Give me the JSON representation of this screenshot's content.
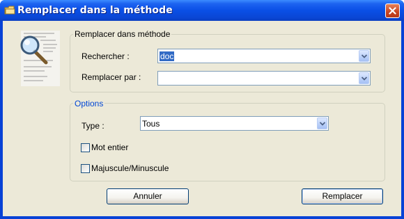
{
  "window": {
    "title": "Remplacer dans la méthode",
    "icon": "folder-icon",
    "close_icon": "close-icon"
  },
  "decoration": {
    "icon": "magnifier-document-icon"
  },
  "replace_group": {
    "legend": "Remplacer dans méthode",
    "search_label": "Rechercher :",
    "search_value": "doc",
    "replace_label": "Remplacer par :",
    "replace_value": ""
  },
  "options_group": {
    "legend": "Options",
    "type_label": "Type :",
    "type_value": "Tous",
    "whole_word_label": "Mot entier",
    "whole_word_checked": false,
    "match_case_label": "Majuscule/Minuscule",
    "match_case_checked": false
  },
  "buttons": {
    "cancel": "Annuler",
    "replace": "Remplacer"
  },
  "colors": {
    "title_bar": "#0a4fe6",
    "dialog_bg": "#ece9d8",
    "options_legend": "#0046d5",
    "selection": "#316ac5"
  }
}
